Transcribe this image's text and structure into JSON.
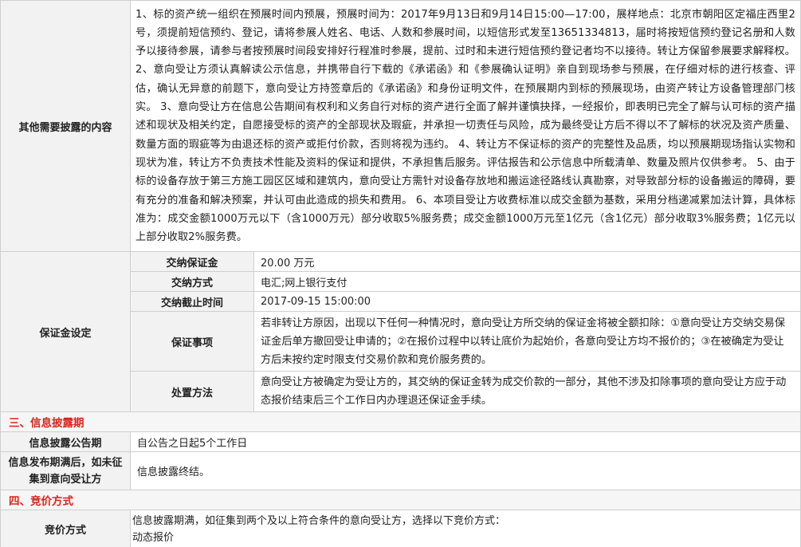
{
  "other_disclosures": {
    "label": "其他需要披露的内容",
    "text": "1、标的资产统一组织在预展时间内预展，预展时间为：2017年9月13日和9月14日15:00—17:00，展样地点：北京市朝阳区定福庄西里2号，须提前短信预约、登记，请将参展人姓名、电话、人数和参展时间，以短信形式发至13651334813，届时将按短信预约登记名册和人数予以接待参展，请参与者按预展时间段安排好行程准时参展，提前、过时和未进行短信预约登记者均不以接待。转让方保留参展要求解释权。 2、意向受让方须认真解读公示信息，并携带自行下载的《承诺函》和《参展确认证明》亲自到现场参与预展，在仔细对标的进行核查、评估，确认无异意的前题下，意向受让方持签章后的《承诺函》和身份证明文件，在预展期内到标的预展现场，由资产转让方设备管理部门核实。 3、意向受让方在信息公告期间有权利和义务自行对标的资产进行全面了解并谨慎抉择，一经报价，即表明已完全了解与认可标的资产描述和现状及相关约定，自愿接受标的资产的全部现状及瑕疵，并承担一切责任与风险，成为最终受让方后不得以不了解标的状况及资产质量、数量方面的瑕疵等为由退还标的资产或拒付价款，否则将视为违约。 4、转让方不保证标的资产的完整性及品质，均以预展期现场指认实物和现状为准，转让方不负责技术性能及资料的保证和提供，不承担售后服务。评估报告和公示信息中所载清单、数量及照片仅供参考。 5、由于标的设备存放于第三方施工园区区域和建筑内，意向受让方需针对设备存放地和搬运途径路线认真勘察，对导致部分标的设备搬运的障碍，要有充分的准备和解决预案，并认可由此造成的损失和费用。 6、本项目受让方收费标准以成交金额为基数，采用分档递减累加法计算，具体标准为：成交金额1000万元以下（含1000万元）部分收取5%服务费；成交金额1000万元至1亿元（含1亿元）部分收取3%服务费；1亿元以上部分收取2%服务费。"
  },
  "deposit": {
    "label": "保证金设定",
    "rows": [
      {
        "label": "交纳保证金",
        "value": "20.00 万元"
      },
      {
        "label": "交纳方式",
        "value": "电汇;网上银行支付"
      },
      {
        "label": "交纳截止时间",
        "value": "2017-09-15 15:00:00"
      },
      {
        "label": "保证事项",
        "value": "若非转让方原因，出现以下任何一种情况时，意向受让方所交纳的保证金将被全额扣除：①意向受让方交纳交易保证金后单方撤回受让申请的；②在报价过程中以转让底价为起始价，各意向受让方均不报价的；③在被确定为受让方后未按约定时限支付交易价款和竞价服务费的。"
      },
      {
        "label": "处置方法",
        "value": "意向受让方被确定为受让方的，其交纳的保证金转为成交价款的一部分，其他不涉及扣除事项的意向受让方应于动态报价结束后三个工作日内办理退还保证金手续。"
      }
    ]
  },
  "section3": {
    "title": "三、信息披露期",
    "rows": [
      {
        "label": "信息披露公告期",
        "value": "自公告之日起5个工作日"
      },
      {
        "label": "信息发布期满后，如未征集到意向受让方",
        "value": "信息披露终结。"
      }
    ]
  },
  "section4": {
    "title": "四、竞价方式",
    "rows": [
      {
        "label": "竞价方式",
        "value_line1": "信息披露期满，如征集到两个及以上符合条件的意向受让方，选择以下竞价方式：",
        "value_line2": "动态报价"
      }
    ]
  }
}
